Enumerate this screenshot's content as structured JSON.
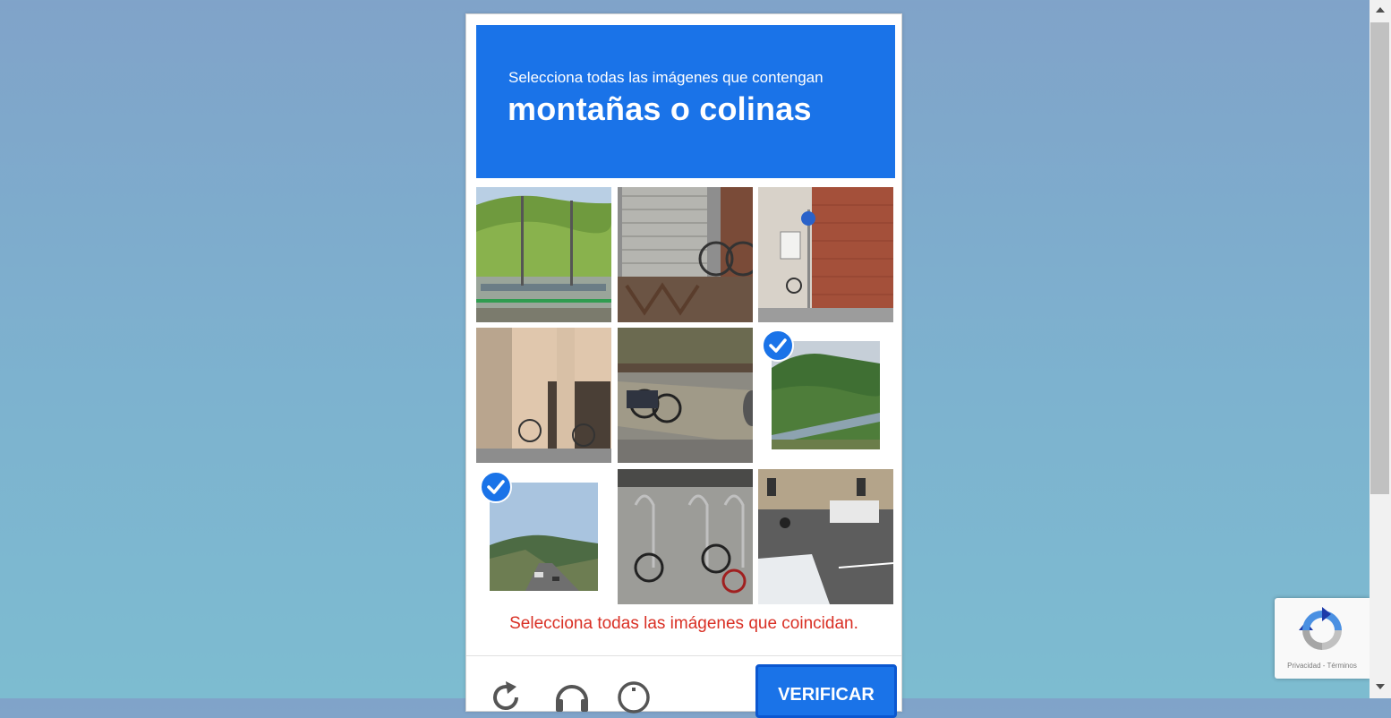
{
  "captcha": {
    "instruction_line1": "Selecciona todas las imágenes que contengan",
    "instruction_line2": "montañas o colinas",
    "error_message": "Selecciona todas las imágenes que coincidan.",
    "verify_label": "VERIFICAR",
    "tiles": [
      {
        "scene": "hillside-with-train",
        "selected": false
      },
      {
        "scene": "bicycles-by-shutter",
        "selected": false
      },
      {
        "scene": "brick-building-sign",
        "selected": false
      },
      {
        "scene": "building-bike-parking",
        "selected": false
      },
      {
        "scene": "bicycles-on-curb",
        "selected": false
      },
      {
        "scene": "forested-hill",
        "selected": true
      },
      {
        "scene": "road-with-hills",
        "selected": true
      },
      {
        "scene": "bike-racks-pavement",
        "selected": false
      },
      {
        "scene": "street-intersection",
        "selected": false
      }
    ],
    "footer_icons": [
      "reload-icon",
      "audio-challenge-icon",
      "info-icon"
    ]
  },
  "recaptcha_badge": {
    "links": "Privacidad - Términos"
  },
  "colors": {
    "accent": "#1a73e8",
    "error": "#d93025"
  }
}
